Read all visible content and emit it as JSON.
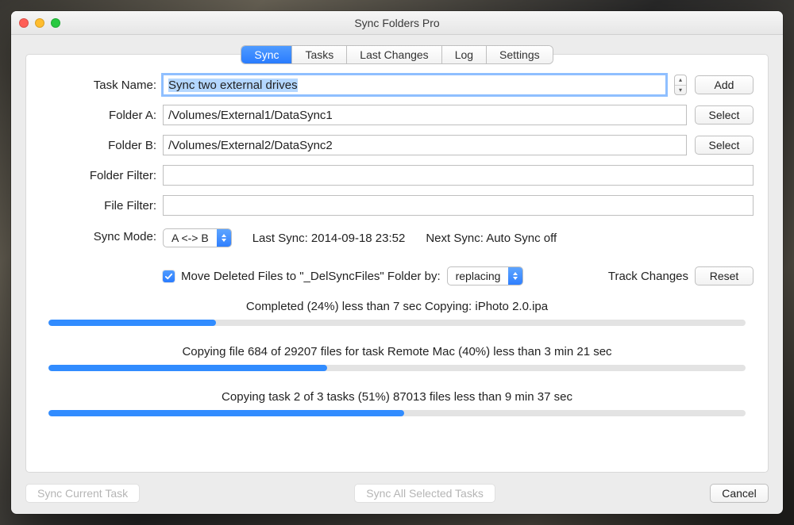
{
  "window_title": "Sync Folders Pro",
  "tabs": [
    "Sync",
    "Tasks",
    "Last Changes",
    "Log",
    "Settings"
  ],
  "active_tab": 0,
  "labels": {
    "task_name": "Task Name:",
    "folder_a": "Folder A:",
    "folder_b": "Folder B:",
    "folder_filter": "Folder Filter:",
    "file_filter": "File Filter:",
    "sync_mode": "Sync Mode:",
    "track_changes": "Track Changes"
  },
  "buttons": {
    "add": "Add",
    "select": "Select",
    "reset": "Reset",
    "sync_current": "Sync Current Task",
    "sync_all": "Sync All Selected Tasks",
    "cancel": "Cancel"
  },
  "fields": {
    "task_name": "Sync two external drives",
    "folder_a": "/Volumes/External1/DataSync1",
    "folder_b": "/Volumes/External2/DataSync2",
    "folder_filter": "",
    "file_filter": ""
  },
  "sync_mode_value": "A <-> B",
  "last_sync_label": "Last Sync: 2014-09-18 23:52",
  "next_sync_label": "Next Sync: Auto Sync off",
  "move_deleted_label": "Move Deleted Files to \"_DelSyncFiles\" Folder by:",
  "move_deleted_mode": "replacing",
  "progress": [
    {
      "text": "Completed (24%) less than 7 sec Copying: iPhoto 2.0.ipa",
      "pct": 24
    },
    {
      "text": "Copying file 684 of 29207 files for task Remote Mac (40%) less than 3 min 21 sec",
      "pct": 40
    },
    {
      "text": "Copying task 2 of 3 tasks (51%) 87013 files less than 9 min 37 sec",
      "pct": 51
    }
  ]
}
